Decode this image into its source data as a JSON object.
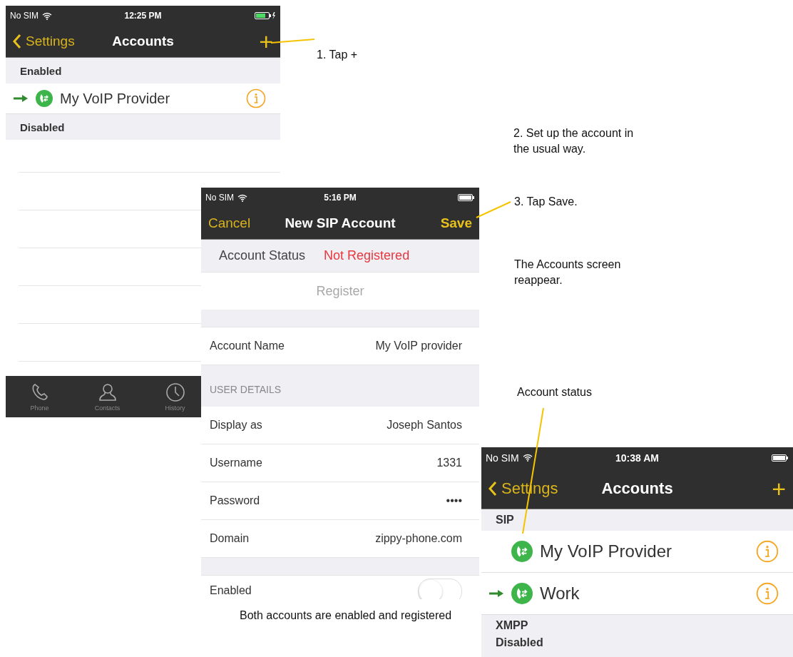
{
  "screens": [
    {
      "kind": "accounts",
      "status_bar": {
        "carrier": "No SIM",
        "time": "12:25 PM",
        "charging": true
      },
      "nav": {
        "back": "Settings",
        "title": "Accounts",
        "action": "+"
      },
      "sections": [
        {
          "header": "Enabled",
          "accounts": [
            {
              "name": "My VoIP Provider",
              "default": true
            }
          ]
        },
        {
          "header": "Disabled"
        }
      ],
      "tab_bar": [
        {
          "label": "Phone"
        },
        {
          "label": "Contacts"
        },
        {
          "label": "History"
        }
      ]
    },
    {
      "kind": "form",
      "status_bar": {
        "carrier": "No SIM",
        "time": "5:16 PM",
        "charging": false
      },
      "nav": {
        "back": "Cancel",
        "title": "New SIP Account",
        "action": "Save"
      },
      "rows": [
        {
          "kind": "status",
          "label": "Account Status",
          "value": "Not Registered"
        },
        {
          "kind": "button",
          "label": "Register",
          "disabled": true
        },
        {
          "kind": "spacer"
        },
        {
          "kind": "field",
          "label": "Account Name",
          "value": "My VoIP provider"
        },
        {
          "kind": "header",
          "label": "USER DETAILS"
        },
        {
          "kind": "field",
          "label": "Display as",
          "value": "Joseph Santos"
        },
        {
          "kind": "field",
          "label": "Username",
          "value": "1331"
        },
        {
          "kind": "field",
          "label": "Password",
          "value": "••••"
        },
        {
          "kind": "field",
          "label": "Domain",
          "value": "zippy-phone.com"
        },
        {
          "kind": "spacer"
        },
        {
          "kind": "toggle",
          "label": "Enabled",
          "on": false
        }
      ]
    },
    {
      "kind": "accounts",
      "status_bar": {
        "carrier": "No SIM",
        "time": "10:38 AM",
        "charging": false
      },
      "nav": {
        "back": "Settings",
        "title": "Accounts",
        "action": "+"
      },
      "sections": [
        {
          "header": "SIP",
          "accounts": [
            {
              "name": "My VoIP Provider",
              "default": false
            },
            {
              "name": "Work",
              "default": true
            }
          ]
        },
        {
          "header": "XMPP"
        },
        {
          "header": "Disabled"
        }
      ]
    }
  ],
  "callouts": [
    {
      "text": "1. Tap +"
    },
    {
      "text": "2. Set up the account in the usual way."
    },
    {
      "text": "3. Tap Save."
    },
    {
      "text": "The Accounts screen reappear."
    },
    {
      "text": "Account status"
    },
    {
      "text": "Both accounts are enabled and registered"
    }
  ]
}
